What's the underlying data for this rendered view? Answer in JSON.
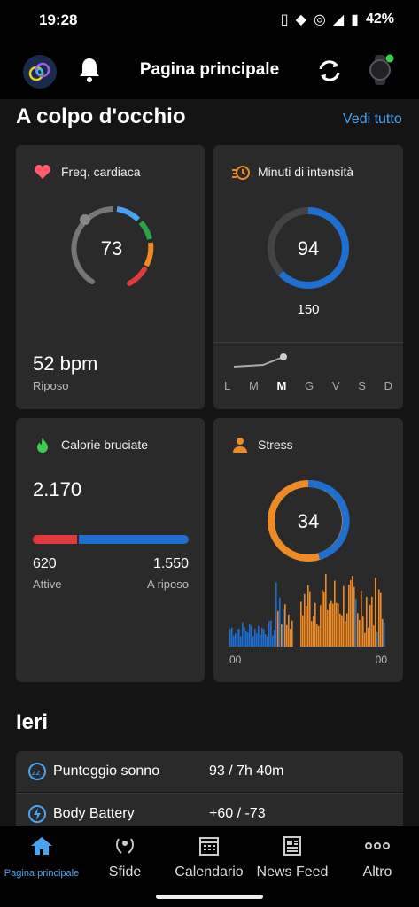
{
  "status_bar": {
    "time": "19:28",
    "battery": "42%"
  },
  "header": {
    "title": "Pagina principale"
  },
  "glance": {
    "title": "A colpo d'occhio",
    "see_all": "Vedi tutto"
  },
  "heart": {
    "title": "Freq. cardiaca",
    "value": "73",
    "bpm": "52 bpm",
    "rest_label": "Riposo"
  },
  "intensity": {
    "title": "Minuti di intensità",
    "value": "94",
    "goal": "150",
    "progress_fraction": 0.63,
    "days": [
      "L",
      "M",
      "M",
      "G",
      "V",
      "S",
      "D"
    ]
  },
  "calories": {
    "title": "Calorie bruciate",
    "total": "2.170",
    "active": "620",
    "active_label": "Attive",
    "rest": "1.550",
    "rest_label": "A riposo"
  },
  "stress": {
    "title": "Stress",
    "value": "34",
    "axis_start": "00",
    "axis_end": "00"
  },
  "yesterday": {
    "title": "Ieri",
    "rows": [
      {
        "label": "Punteggio sonno",
        "value": "93 / 7h 40m"
      },
      {
        "label": "Body Battery",
        "value": "+60 / -73"
      }
    ]
  },
  "nav": [
    {
      "label": "Pagina principale",
      "icon": "home-icon"
    },
    {
      "label": "Sfide",
      "icon": "laurel-icon"
    },
    {
      "label": "Calendario",
      "icon": "calendar-icon"
    },
    {
      "label": "News Feed",
      "icon": "newsfeed-icon"
    },
    {
      "label": "Altro",
      "icon": "more-icon"
    }
  ],
  "colors": {
    "accent": "#4aa3f0",
    "blue": "#1e6fd0",
    "orange": "#f08a24",
    "red": "#e03a3a",
    "card": "#2a2a2a"
  }
}
